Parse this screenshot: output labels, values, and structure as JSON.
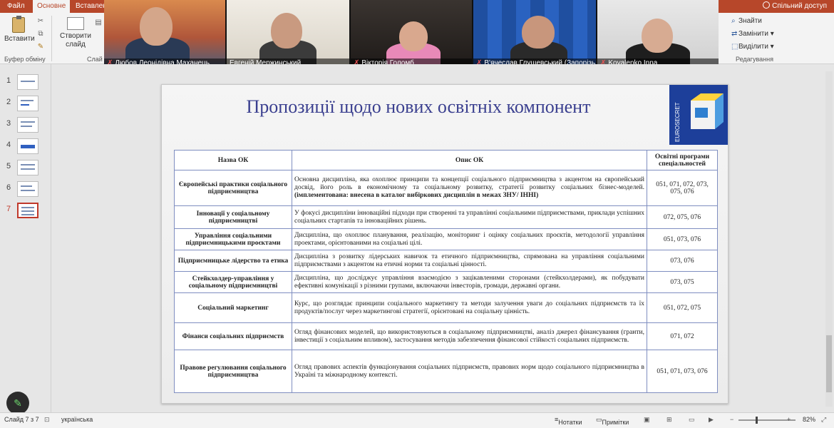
{
  "tabs": [
    {
      "label": "Файл",
      "active": false
    },
    {
      "label": "Основне",
      "active": true
    },
    {
      "label": "Вставлен",
      "active": false
    }
  ],
  "share_label": "Спільний доступ",
  "ribbon": {
    "paste_label": "Вставити",
    "clipboard_label": "Буфер обміну",
    "new_slide_label": "Створити слайд",
    "slides_label": "Слай",
    "find_label": "Знайти",
    "replace_label": "Замінити",
    "select_label": "Виділити",
    "editing_label": "Редагування"
  },
  "participants": [
    {
      "name": "Любов Леонідівна Маханець",
      "muted": true
    },
    {
      "name": "Евгеній Мержинський",
      "muted": false
    },
    {
      "name": "Вікторія Голомб",
      "muted": true
    },
    {
      "name": "В'ячеслав Глущевський (Запорізь...",
      "muted": true
    },
    {
      "name": "Kovalenko Inna",
      "muted": true
    }
  ],
  "thumbnails": [
    "1",
    "2",
    "3",
    "4",
    "5",
    "6",
    "7"
  ],
  "active_slide": 7,
  "logo_text": "EUROSECRET",
  "slide": {
    "title": "Пропозиції щодо нових освітніх компонент",
    "headers": [
      "Назва ОК",
      "Опис ОК",
      "Освітні програми спеціальностей"
    ],
    "rows": [
      {
        "name": "Європейські практики соціального підприємництва",
        "desc": "Основна дисципліна, яка охоплює принципи та концепції соціального підприємництва з акцентом на європейський досвід, його роль в економічному та соціальному розвитку, стратегії розвитку соціальних бізнес-моделей.",
        "desc_bold": "(імплементована: внесена в каталог вибіркових дисциплін в межах ЗНУ/ ІННІ)",
        "prog": "051, 071, 072, 073, 075, 076"
      },
      {
        "name": "Інновації у соціальному підприємництві",
        "desc": "У фокусі дисципліни інноваційні підходи при створенні та управлінні соціальними підприємствами, приклади успішних соціальних стартапів та інноваційних рішень.",
        "desc_bold": "",
        "prog": "072, 075, 076"
      },
      {
        "name": "Управління соціальними підприємницькими проєктами",
        "desc": "Дисципліна, що охоплює планування, реалізацію, моніторинг і оцінку соціальних проєктів, методології управління проектами, орієнтованими на соціальні цілі.",
        "desc_bold": "",
        "prog": "051, 073, 076"
      },
      {
        "name": "Підприємницьке лідерство та етика",
        "desc": "Дисципліна з розвитку лідерських навичок та етичного підприємництва, спрямована на управління соціальними підприємствами з акцентом на етичні норми та соціальні цінності.",
        "desc_bold": "",
        "prog": "073, 076"
      },
      {
        "name": "Стейкхолдер-управління у соціальному підприємництві",
        "desc": "Дисципліна, що досліджує управління взаємодією з зацікавленими сторонами (стейкхолдерами), як побудувати ефективні комунікації з різними групами, включаючи інвесторів, громади, державні органи.",
        "desc_bold": "",
        "prog": "073, 075"
      },
      {
        "name": "Соціальний маркетинг",
        "desc": "Курс, що розглядає принципи соціального маркетингу та методи залучення уваги до соціальних підприємств та їх продуктів/послуг через маркетингові стратегії, орієнтовані на соціальну цінність.",
        "desc_bold": "",
        "prog": "051, 072, 075"
      },
      {
        "name": "Фінанси соціальних підприємств",
        "desc": "Огляд фінансових моделей, що використовуються в соціальному підприємництві, аналіз джерел фінансування (гранти, інвестиції з соціальним впливом), застосування методів забезпечення фінансової стійкості соціальних підприємств.",
        "desc_bold": "",
        "prog": "071, 072"
      },
      {
        "name": "Правове регулювання соціального підприємництва",
        "desc": "Огляд правових аспектів функціонування соціальних підприємств, правових норм щодо соціального підприємництва в Україні та міжнародному контексті.",
        "desc_bold": "",
        "prog": "051, 071, 073, 076"
      }
    ]
  },
  "status": {
    "slide_info": "Слайд 7 з 7",
    "language": "українська",
    "notes_label": "Нотатки",
    "comments_label": "Примітки",
    "zoom": "82%"
  }
}
